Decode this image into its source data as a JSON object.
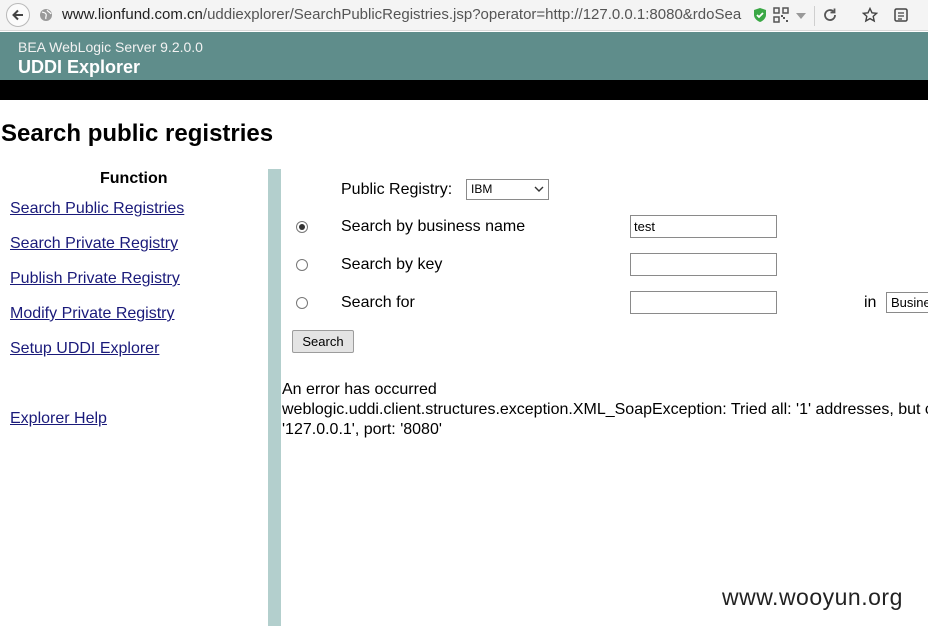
{
  "browser": {
    "url_host": "www.lionfund.com.cn",
    "url_rest": "/uddiexplorer/SearchPublicRegistries.jsp?operator=http://127.0.0.1:8080&rdoSea"
  },
  "header": {
    "brand": "BEA WebLogic Server 9.2.0.0",
    "product": "UDDI Explorer"
  },
  "page": {
    "title": "Search public registries"
  },
  "sidebar": {
    "heading": "Function",
    "links": [
      "Search Public Registries",
      "Search Private Registry",
      "Publish Private Registry",
      "Modify Private Registry",
      "Setup UDDI Explorer"
    ],
    "help": "Explorer Help"
  },
  "form": {
    "registry_label": "Public Registry:",
    "registry_value": "IBM",
    "options": [
      {
        "label": "Search by business name",
        "value": "test",
        "selected": true
      },
      {
        "label": "Search by key",
        "value": "",
        "selected": false
      },
      {
        "label": "Search for",
        "value": "",
        "selected": false
      }
    ],
    "in_label": "in",
    "in_value": "Busine",
    "search_button": "Search"
  },
  "error": {
    "line1": "An error has occurred",
    "line2": "weblogic.uddi.client.structures.exception.XML_SoapException: Tried all: '1' addresses, but c",
    "line3": "'127.0.0.1', port: '8080'"
  },
  "watermark": "www.wooyun.org"
}
